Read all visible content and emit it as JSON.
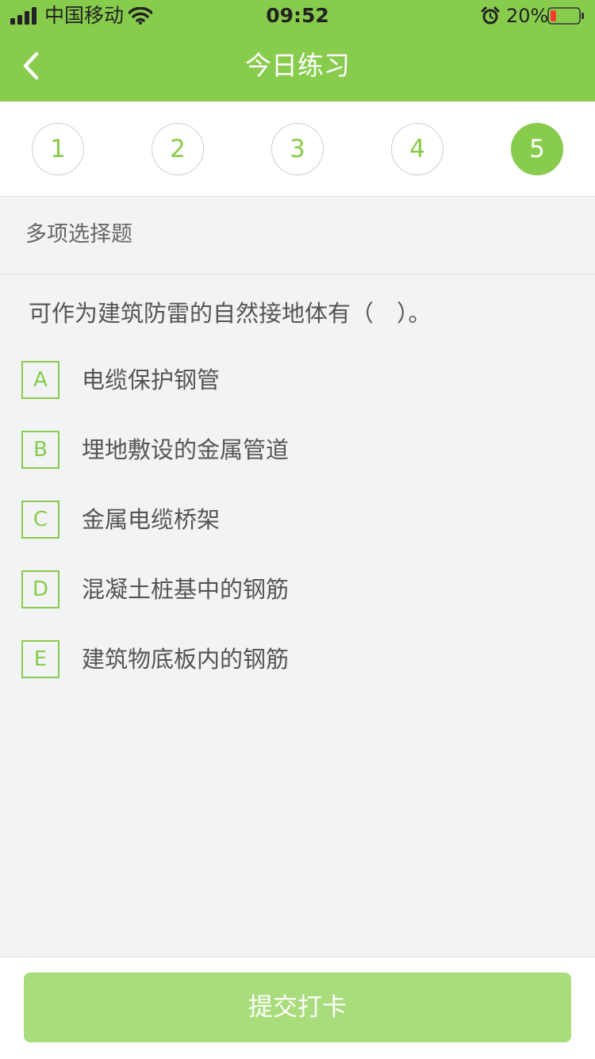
{
  "status_bar": {
    "carrier": "中国移动",
    "time": "09:52",
    "battery": "20%"
  },
  "header": {
    "title": "今日练习",
    "back_icon": "chevron-left-icon"
  },
  "steps": {
    "items": [
      "1",
      "2",
      "3",
      "4",
      "5"
    ],
    "active": "5"
  },
  "question": {
    "type": "多项选择题",
    "text": "可作为建筑防雷的自然接地体有（　）。",
    "options": [
      {
        "letter": "A",
        "text": "电缆保护钢管"
      },
      {
        "letter": "B",
        "text": "埋地敷设的金属管道"
      },
      {
        "letter": "C",
        "text": "金属电缆桥架"
      },
      {
        "letter": "D",
        "text": "混凝土桩基中的钢筋"
      },
      {
        "letter": "E",
        "text": "建筑物底板内的钢筋"
      }
    ]
  },
  "footer": {
    "submit_label": "提交打卡"
  },
  "colors": {
    "brand_green": "#88cc4d",
    "button_green": "#a9dd7b",
    "background": "#f2f3f5",
    "battery_low": "#ff3b30"
  }
}
